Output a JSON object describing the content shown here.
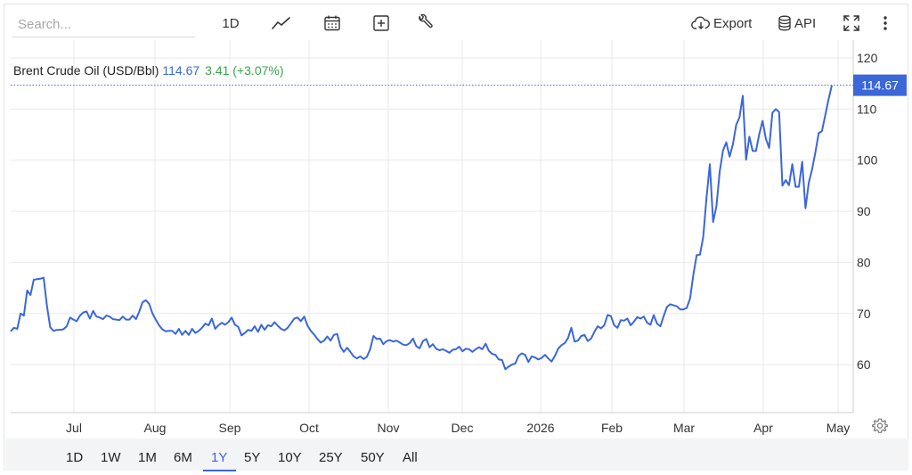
{
  "toolbar": {
    "search_placeholder": "Search...",
    "interval_label": "1D",
    "export_label": "Export",
    "api_label": "API",
    "icons": [
      "line-chart-icon",
      "calendar-icon",
      "plus-square-icon",
      "wrench-icon",
      "cloud-download-icon",
      "database-icon",
      "fullscreen-icon",
      "more-vertical-icon"
    ]
  },
  "header": {
    "name": "Brent Crude Oil (USD/Bbl)",
    "price": "114.67",
    "change": "3.41 (+3.07%)"
  },
  "ranges": {
    "items": [
      "1D",
      "1W",
      "1M",
      "6M",
      "1Y",
      "5Y",
      "10Y",
      "25Y",
      "50Y",
      "All"
    ],
    "active": "1Y"
  },
  "colors": {
    "line": "#3b67d9",
    "up": "#3aa54a",
    "grid": "#e9e9e9"
  },
  "chart_data": {
    "type": "line",
    "series": [
      {
        "name": "Brent Crude Oil (USD/Bbl)",
        "values": [
          66.5,
          67.2,
          67.0,
          70.0,
          69.6,
          74.5,
          73.6,
          76.6,
          76.7,
          76.8,
          77.0,
          71.5,
          67.3,
          66.6,
          66.8,
          66.8,
          66.9,
          67.5,
          69.2,
          68.8,
          68.5,
          69.6,
          70.2,
          70.4,
          69.0,
          70.5,
          69.4,
          69.2,
          68.9,
          69.6,
          69.4,
          68.9,
          68.8,
          68.7,
          69.4,
          68.8,
          68.8,
          69.6,
          68.9,
          70.4,
          72.2,
          72.6,
          71.9,
          70.0,
          68.8,
          67.7,
          66.9,
          66.5,
          66.6,
          66.6,
          66.0,
          67.0,
          65.8,
          66.6,
          65.8,
          67.0,
          66.2,
          66.6,
          67.2,
          68.0,
          67.7,
          69.0,
          67.0,
          67.7,
          68.2,
          67.8,
          68.3,
          69.2,
          67.8,
          67.4,
          65.7,
          66.2,
          66.8,
          66.6,
          67.5,
          66.4,
          67.8,
          66.8,
          67.7,
          67.5,
          68.3,
          67.6,
          67.0,
          66.7,
          67.2,
          68.1,
          69.0,
          69.2,
          68.5,
          69.4,
          67.6,
          66.6,
          65.9,
          65.0,
          64.3,
          64.7,
          65.5,
          64.7,
          65.8,
          66.0,
          63.5,
          62.5,
          63.3,
          62.5,
          61.6,
          61.2,
          61.6,
          61.1,
          61.5,
          63.0,
          65.6,
          65.0,
          65.1,
          64.0,
          64.6,
          64.8,
          64.5,
          64.7,
          64.3,
          63.9,
          63.8,
          64.2,
          65.1,
          63.6,
          63.2,
          64.6,
          65.0,
          63.4,
          64.0,
          63.1,
          62.8,
          63.0,
          62.7,
          62.3,
          62.9,
          63.0,
          63.5,
          62.6,
          63.1,
          63.0,
          62.5,
          63.0,
          63.4,
          63.0,
          64.1,
          62.7,
          62.1,
          61.9,
          61.0,
          60.9,
          59.1,
          59.6,
          60.0,
          60.2,
          61.7,
          62.2,
          61.9,
          60.5,
          61.6,
          61.4,
          61.0,
          61.3,
          61.9,
          61.2,
          60.6,
          61.7,
          63.1,
          63.8,
          64.2,
          65.2,
          67.2,
          64.5,
          64.7,
          65.6,
          65.8,
          64.6,
          65.1,
          66.4,
          67.5,
          67.1,
          67.7,
          69.7,
          69.5,
          67.7,
          67.2,
          68.7,
          68.6,
          69.0,
          67.7,
          68.4,
          69.3,
          69.0,
          69.4,
          68.2,
          67.8,
          69.7,
          68.0,
          67.5,
          69.5,
          71.3,
          71.8,
          71.6,
          71.4,
          70.8,
          70.8,
          71.1,
          72.9,
          77.6,
          81.4,
          81.5,
          85.0,
          92.7,
          99.2,
          87.9,
          91.0,
          97.8,
          101.9,
          103.5,
          100.7,
          103.1,
          106.9,
          108.4,
          112.6,
          100.1,
          104.6,
          101.8,
          101.8,
          105.1,
          107.7,
          104.2,
          102.4,
          109.3,
          110.0,
          109.4,
          95.0,
          96.1,
          95.1,
          99.2,
          94.8,
          94.8,
          99.7,
          90.6,
          95.6,
          98.2,
          101.5,
          105.3,
          105.7,
          108.8,
          111.9,
          114.67
        ]
      }
    ],
    "x_tick_labels": [
      "Jul",
      "Aug",
      "Sep",
      "Oct",
      "Nov",
      "Dec",
      "2026",
      "Feb",
      "Mar",
      "Apr",
      "May"
    ],
    "y_ticks": [
      60,
      70,
      80,
      90,
      100,
      110,
      120
    ],
    "ylim": [
      50.6,
      123.5
    ],
    "last_value": 114.67,
    "last_value_label": "114.67",
    "title": "Brent Crude Oil (USD/Bbl)",
    "xlabel": "",
    "ylabel": "",
    "grid": true,
    "y_axis_side": "right"
  }
}
